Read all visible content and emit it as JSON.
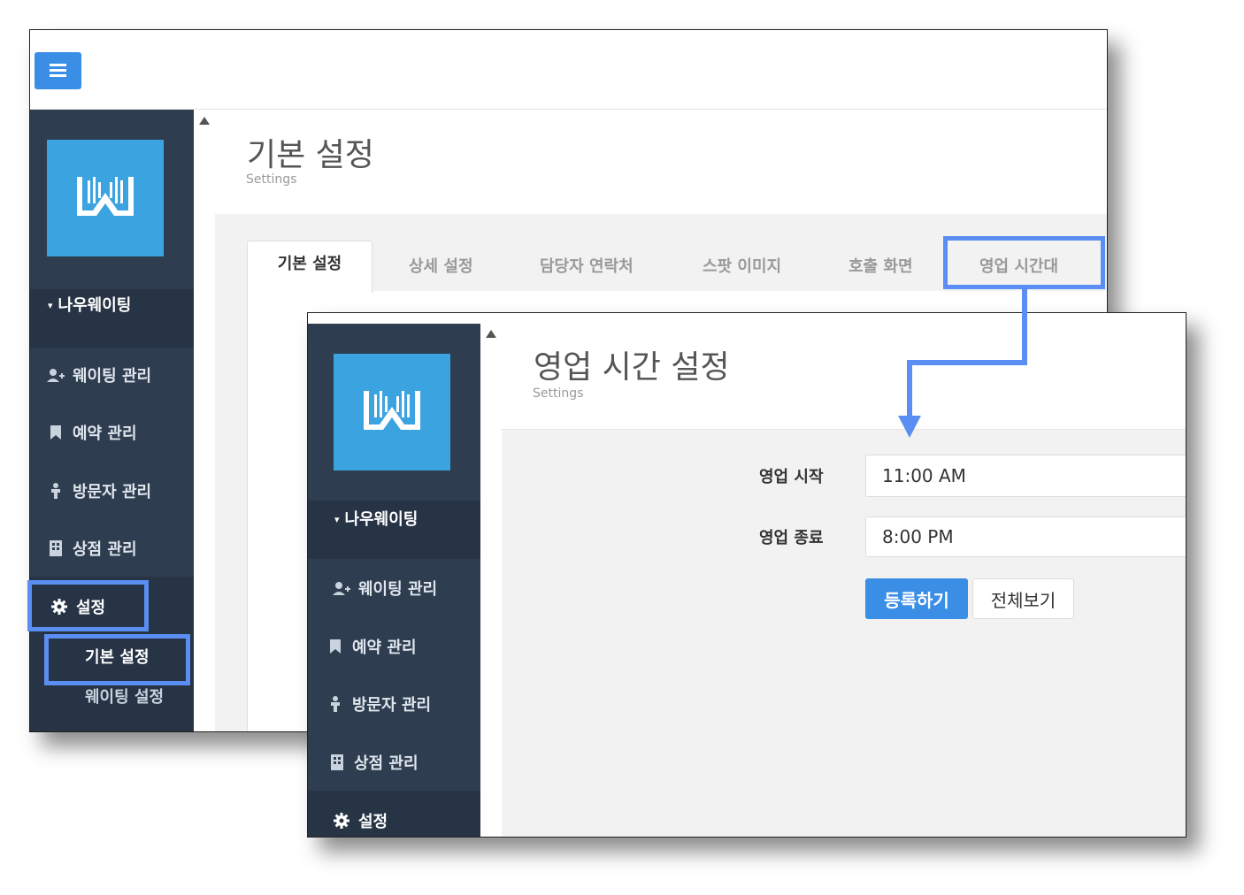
{
  "back": {
    "brand": "나우웨이팅",
    "nav": [
      {
        "label": "웨이팅 관리",
        "icon": "user-plus-icon"
      },
      {
        "label": "예약 관리",
        "icon": "bookmark-icon"
      },
      {
        "label": "방문자 관리",
        "icon": "person-icon"
      },
      {
        "label": "상점 관리",
        "icon": "building-icon"
      },
      {
        "label": "설정",
        "icon": "gear-icon"
      }
    ],
    "submenu": [
      "기본 설정",
      "웨이팅 설정"
    ],
    "page_title": "기본 설정",
    "page_subtitle": "Settings",
    "tabs": [
      "기본 설정",
      "상세 설정",
      "담당자 연락처",
      "스팟 이미지",
      "호출 화면",
      "영업 시간대"
    ]
  },
  "front": {
    "brand": "나우웨이팅",
    "nav": [
      {
        "label": "웨이팅 관리",
        "icon": "user-plus-icon"
      },
      {
        "label": "예약 관리",
        "icon": "bookmark-icon"
      },
      {
        "label": "방문자 관리",
        "icon": "person-icon"
      },
      {
        "label": "상점 관리",
        "icon": "building-icon"
      },
      {
        "label": "설정",
        "icon": "gear-icon"
      }
    ],
    "page_title": "영업 시간 설정",
    "page_subtitle": "Settings",
    "form": {
      "start_label": "영업 시작",
      "start_value": "11:00 AM",
      "end_label": "영업 종료",
      "end_value": "8:00 PM",
      "submit_label": "등록하기",
      "view_all_label": "전체보기"
    }
  },
  "colors": {
    "accent": "#3a8ee6",
    "highlight": "#5a8ef2",
    "sidebar": "#2e3d4f",
    "logo": "#3ba4e0"
  }
}
